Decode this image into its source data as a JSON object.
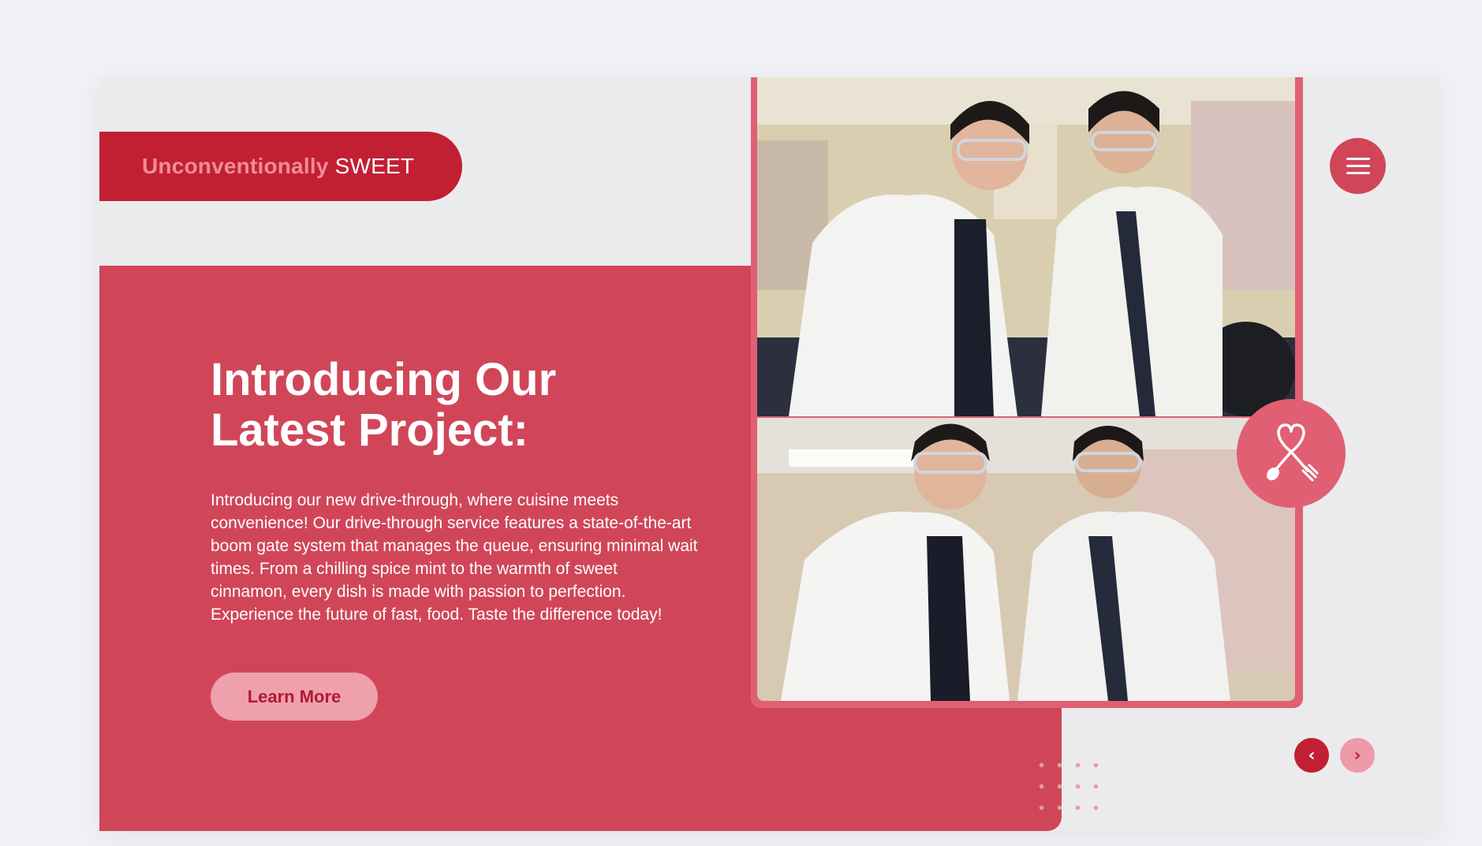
{
  "brand": {
    "highlight": "Unconventionally",
    "rest": "SWEET"
  },
  "hero": {
    "title_line1": "Introducing Our",
    "title_line2": "Latest Project:",
    "body": "Introducing our new drive-through, where cuisine meets convenience! Our drive-through service features a state-of-the-art boom gate system that manages the queue, ensuring minimal wait times. From a chilling spice mint to the warmth of sweet cinnamon, every dish is made with passion to perfection. Experience the future of fast, food. Taste the difference today!",
    "cta_label": "Learn More"
  },
  "icons": {
    "menu": "hamburger-menu-icon",
    "badge": "heart-spoon-fork-icon",
    "prev": "chevron-left-icon",
    "next": "chevron-right-icon"
  },
  "colors": {
    "accent": "#c21f33",
    "panel": "#d04658",
    "frame": "#e05f73",
    "soft_pink": "#efa0ad",
    "background": "#ebebed"
  }
}
